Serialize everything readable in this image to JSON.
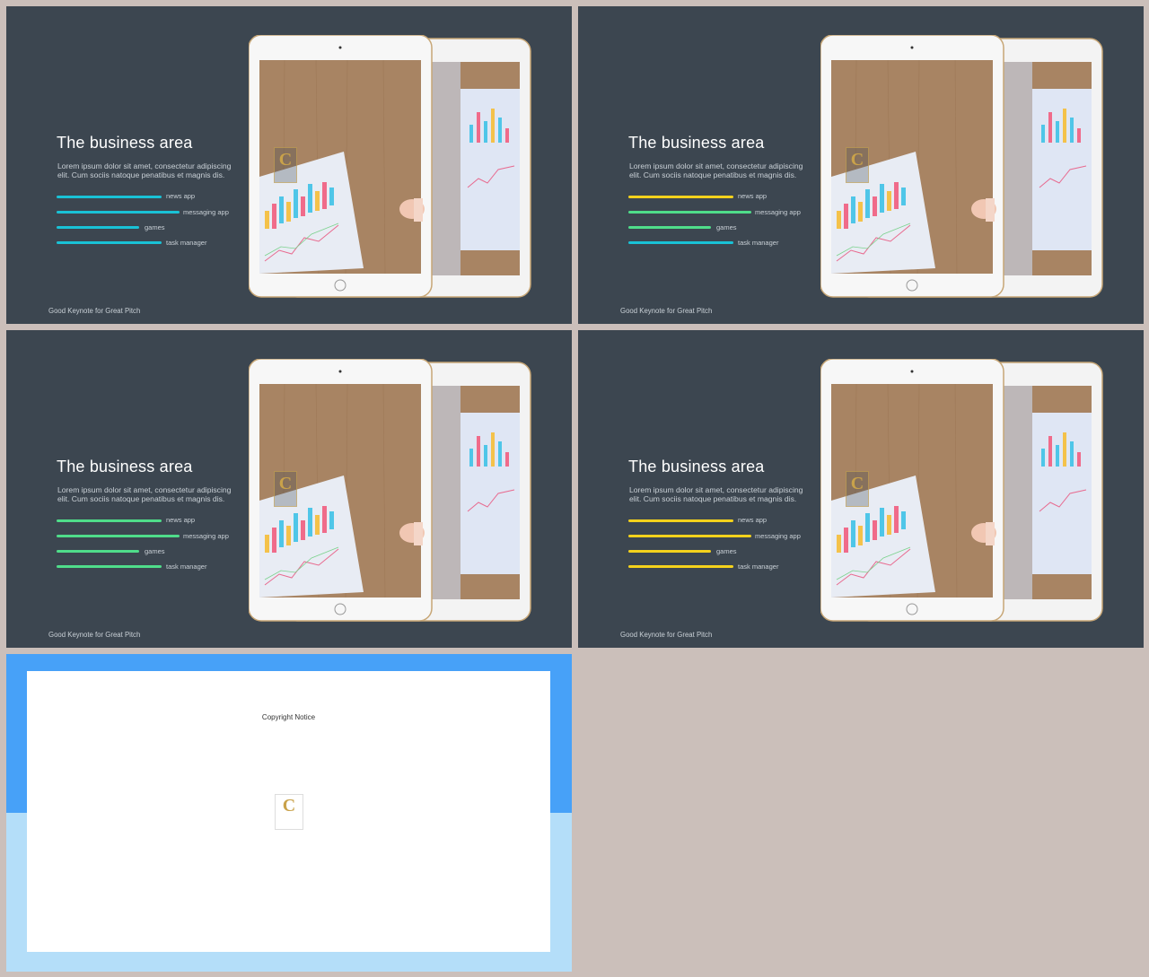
{
  "slides": [
    {
      "title": "The business area",
      "body": "Lorem ipsum dolor sit amet, consectetur adipiscing elit. Cum sociis natoque penatibus et magnis dis.",
      "bars": [
        {
          "label": "news app",
          "color": "#19c2d6",
          "colors": [
            "#19c2d6"
          ]
        },
        {
          "label": "messaging app",
          "color": "#19c2d6"
        },
        {
          "label": "games",
          "color": "#19c2d6"
        },
        {
          "label": "task manager",
          "color": "#19c2d6"
        }
      ],
      "footer": "Good Keynote for Great Pitch"
    },
    {
      "title": "The business area",
      "body": "Lorem ipsum dolor sit amet, consectetur adipiscing elit. Cum sociis natoque penatibus et magnis dis.",
      "bars": [
        {
          "label": "news app",
          "color": "#f4d21c"
        },
        {
          "label": "messaging app",
          "color": "#4fdd8a"
        },
        {
          "label": "games",
          "color": "#4fdd8a"
        },
        {
          "label": "task manager",
          "color": "#19c2d6"
        }
      ],
      "footer": "Good Keynote for Great Pitch"
    },
    {
      "title": "The business area",
      "body": "Lorem ipsum dolor sit amet, consectetur adipiscing elit. Cum sociis natoque penatibus et magnis dis.",
      "bars": [
        {
          "label": "news app",
          "color": "#4fdd8a"
        },
        {
          "label": "messaging app",
          "color": "#4fdd8a"
        },
        {
          "label": "games",
          "color": "#4fdd8a"
        },
        {
          "label": "task manager",
          "color": "#4fdd8a"
        }
      ],
      "footer": "Good Keynote for Great Pitch"
    },
    {
      "title": "The business area",
      "body": "Lorem ipsum dolor sit amet, consectetur adipiscing elit. Cum sociis natoque penatibus et magnis dis.",
      "bars": [
        {
          "label": "news app",
          "color": "#f4d21c"
        },
        {
          "label": "messaging app",
          "color": "#f4d21c"
        },
        {
          "label": "games",
          "color": "#f4d21c"
        },
        {
          "label": "task manager",
          "color": "#f4d21c"
        }
      ],
      "footer": "Good Keynote for Great Pitch"
    }
  ],
  "copyright": {
    "title": "Copyright Notice",
    "logo_letter": "C"
  },
  "logo_letter": "C",
  "logo_icon": "brand-logo-icon",
  "tablet_icon": "tablet-mockup-icon"
}
